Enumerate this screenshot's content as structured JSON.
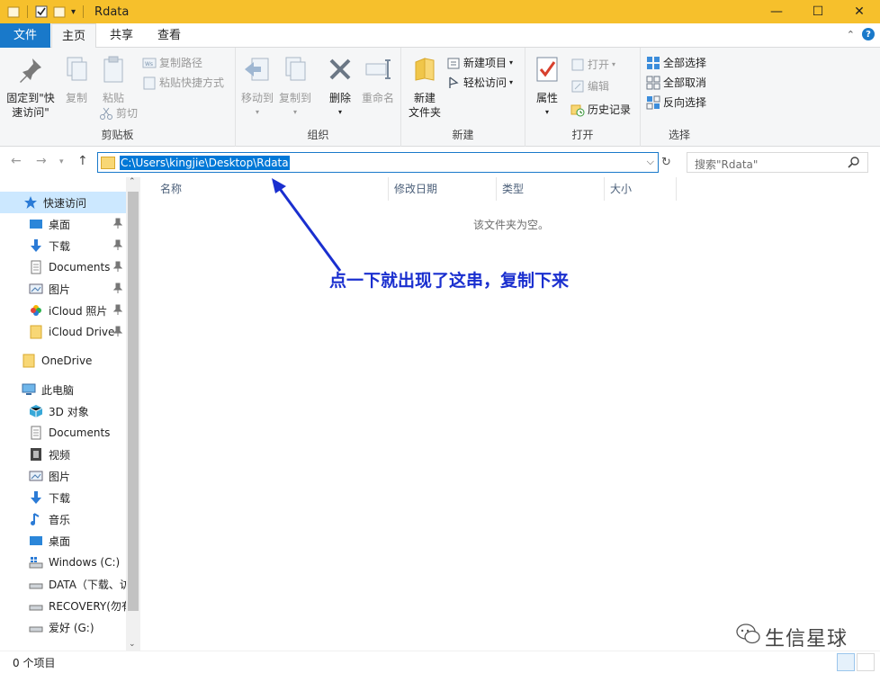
{
  "window": {
    "title": "Rdata",
    "minimize": "—",
    "maximize": "☐",
    "close": "✕"
  },
  "tabs": {
    "file": "文件",
    "home": "主页",
    "share": "共享",
    "view": "查看"
  },
  "ribbon": {
    "clipboard": {
      "label": "剪贴板",
      "pin": "固定到\"快\n速访问\"",
      "copy": "复制",
      "paste": "粘贴",
      "copy_path": "复制路径",
      "paste_shortcut": "粘贴快捷方式",
      "cut": "剪切"
    },
    "organize": {
      "label": "组织",
      "move_to": "移动到",
      "copy_to": "复制到",
      "delete": "删除",
      "rename": "重命名"
    },
    "new": {
      "label": "新建",
      "new_folder": "新建\n文件夹",
      "new_item": "新建项目",
      "easy_access": "轻松访问"
    },
    "open": {
      "label": "打开",
      "properties": "属性",
      "open": "打开",
      "edit": "编辑",
      "history": "历史记录"
    },
    "select": {
      "label": "选择",
      "select_all": "全部选择",
      "select_none": "全部取消",
      "invert": "反向选择"
    }
  },
  "address": {
    "path": "C:\\Users\\kingjie\\Desktop\\Rdata",
    "search_placeholder": "搜索\"Rdata\""
  },
  "nav": {
    "quick_access": "快速访问",
    "quick": [
      "桌面",
      "下载",
      "Documents",
      "图片",
      "iCloud 照片",
      "iCloud Drive"
    ],
    "onedrive": "OneDrive",
    "this_pc": "此电脑",
    "pc": [
      "3D 对象",
      "Documents",
      "视频",
      "图片",
      "下载",
      "音乐",
      "桌面",
      "Windows (C:)",
      "DATA（下载、访",
      "RECOVERY(勿有",
      "爱好 (G:)"
    ]
  },
  "columns": [
    "名称",
    "修改日期",
    "类型",
    "大小"
  ],
  "content": {
    "empty_text": "该文件夹为空。",
    "annotation": "点一下就出现了这串，复制下来"
  },
  "status": {
    "count": "0 个项目"
  },
  "watermark": "生信星球",
  "colors": {
    "titlebar": "#f6c02c",
    "accent": "#1979ca",
    "annotation": "#1a2fcf"
  }
}
